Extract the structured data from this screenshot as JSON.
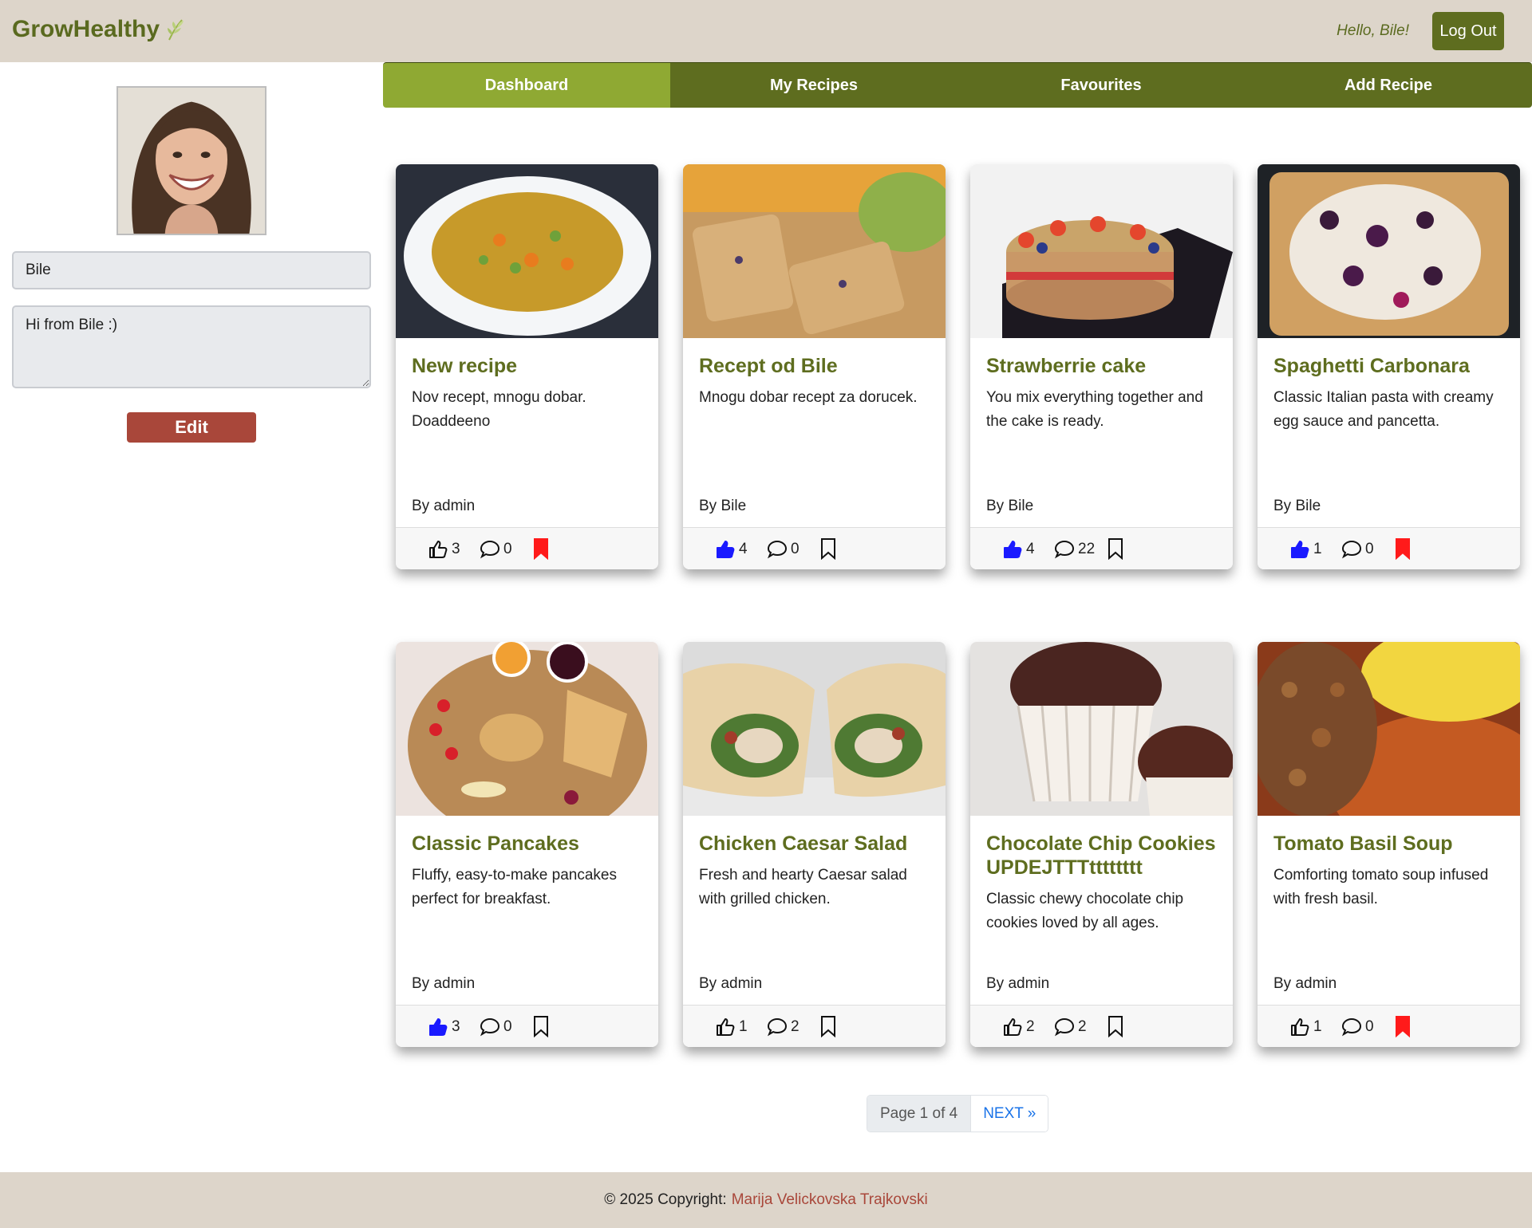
{
  "header": {
    "brand": "GrowHealthy",
    "brand_icon": "leaf-icon",
    "greeting": "Hello, Bile!",
    "logout_label": "Log Out"
  },
  "profile": {
    "name_value": "Bile",
    "bio_value": "Hi from Bile :)",
    "edit_label": "Edit"
  },
  "nav": {
    "tabs": [
      {
        "label": "Dashboard",
        "active": true
      },
      {
        "label": "My Recipes",
        "active": false
      },
      {
        "label": "Favourites",
        "active": false
      },
      {
        "label": "Add Recipe",
        "active": false
      }
    ]
  },
  "recipes": [
    {
      "title": "New recipe",
      "description": "Nov recept, mnogu dobar. Doaddeeno",
      "author": "By admin",
      "likes": "3",
      "liked": false,
      "comments": "0",
      "saved": true
    },
    {
      "title": "Recept od Bile",
      "description": "Mnogu dobar recept za dorucek.",
      "author": "By Bile",
      "likes": "4",
      "liked": true,
      "comments": "0",
      "saved": false
    },
    {
      "title": "Strawberrie cake",
      "description": "You mix everything together and the cake is ready.",
      "author": "By Bile",
      "likes": "4",
      "liked": true,
      "comments": "22",
      "saved": false
    },
    {
      "title": "Spaghetti Carbonara",
      "description": "Classic Italian pasta with creamy egg sauce and pancetta.",
      "author": "By Bile",
      "likes": "1",
      "liked": true,
      "comments": "0",
      "saved": true
    },
    {
      "title": "Classic Pancakes",
      "description": "Fluffy, easy-to-make pancakes perfect for breakfast.",
      "author": "By admin",
      "likes": "3",
      "liked": true,
      "comments": "0",
      "saved": false
    },
    {
      "title": "Chicken Caesar Salad",
      "description": "Fresh and hearty Caesar salad with grilled chicken.",
      "author": "By admin",
      "likes": "1",
      "liked": false,
      "comments": "2",
      "saved": false
    },
    {
      "title": "Chocolate Chip Cookies UPDEJTTTtttttttt",
      "description": "Classic chewy chocolate chip cookies loved by all ages.",
      "author": "By admin",
      "likes": "2",
      "liked": false,
      "comments": "2",
      "saved": false
    },
    {
      "title": "Tomato Basil Soup",
      "description": "Comforting tomato soup infused with fresh basil.",
      "author": "By admin",
      "likes": "1",
      "liked": false,
      "comments": "0",
      "saved": true
    }
  ],
  "pagination": {
    "info": "Page 1 of 4",
    "next_label": "NEXT »"
  },
  "footer": {
    "copyright": "© 2025 Copyright:",
    "author": "Marija Velickovska Trajkovski"
  },
  "colors": {
    "brand_green": "#5e6d1f",
    "active_tab": "#8fa933",
    "header_bg": "#ddd5ca",
    "edit_button": "#a9473a",
    "liked_blue": "#1a1aff",
    "saved_red": "#ff1a1a"
  }
}
